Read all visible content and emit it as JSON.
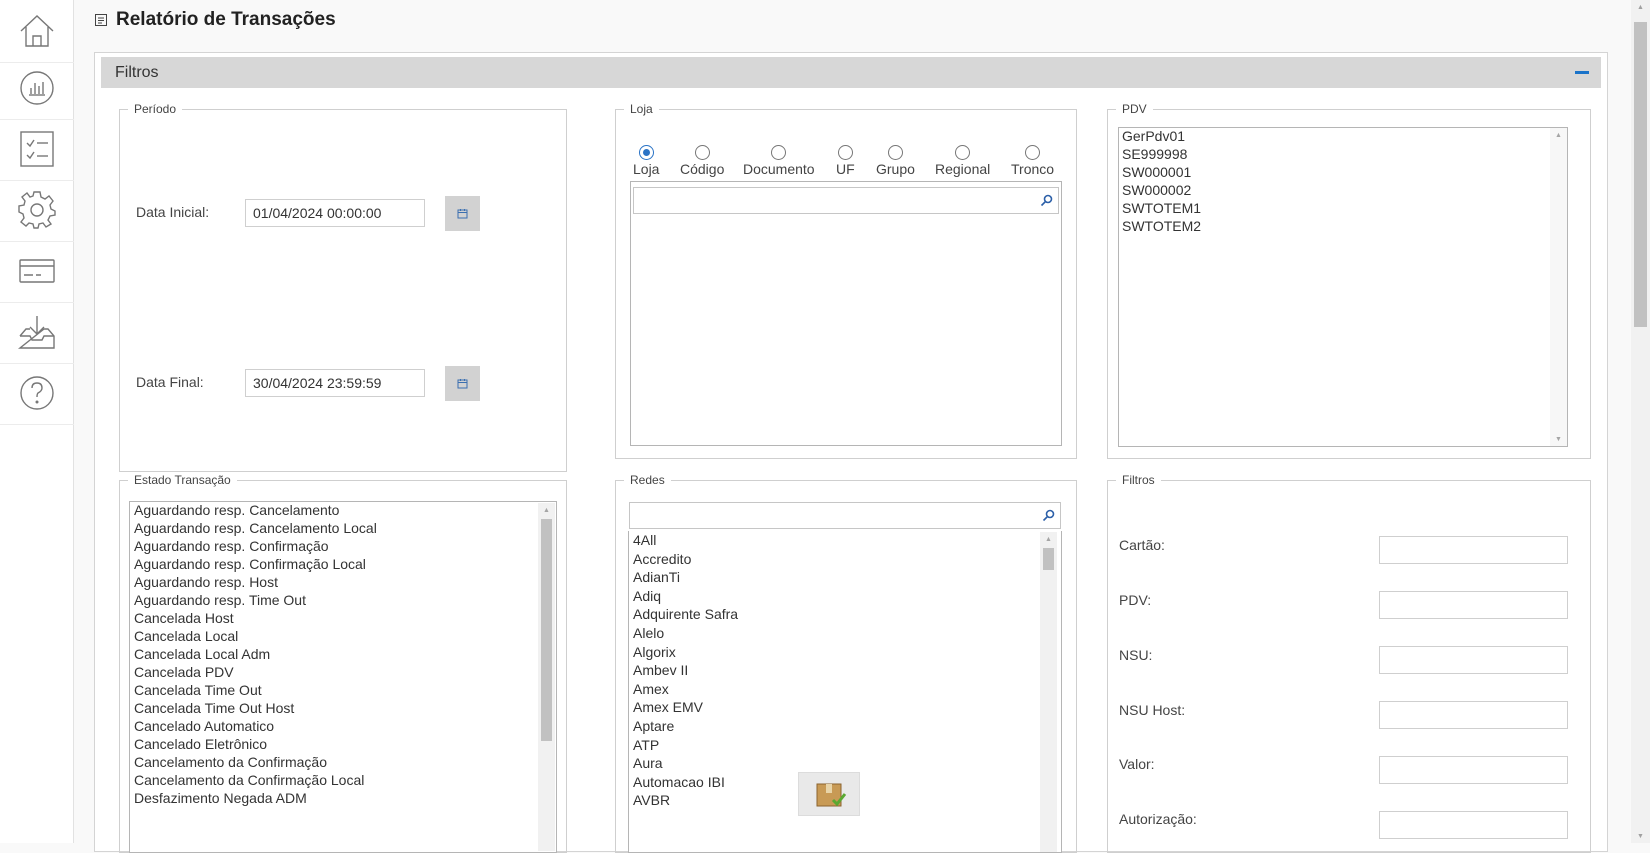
{
  "page": {
    "title": "Relatório de Transações"
  },
  "sidebar": {
    "items": [
      {
        "icon": "home-icon"
      },
      {
        "icon": "chart-icon"
      },
      {
        "icon": "checklist-icon"
      },
      {
        "icon": "gear-icon"
      },
      {
        "icon": "card-icon"
      },
      {
        "icon": "download-tray-icon"
      },
      {
        "icon": "help-icon"
      }
    ]
  },
  "filters_panel": {
    "title": "Filtros",
    "collapse_icon": "minus-icon"
  },
  "periodo": {
    "legend": "Período",
    "start_label": "Data Inicial:",
    "start_value": "01/04/2024 00:00:00",
    "end_label": "Data Final:",
    "end_value": "30/04/2024 23:59:59"
  },
  "loja": {
    "legend": "Loja",
    "options": [
      "Loja",
      "Código",
      "Documento",
      "UF",
      "Grupo",
      "Regional",
      "Tronco"
    ],
    "selected": "Loja",
    "search_value": ""
  },
  "pdv": {
    "legend": "PDV",
    "items": [
      "GerPdv01",
      "SE999998",
      "SW000001",
      "SW000002",
      "SWTOTEM1",
      "SWTOTEM2"
    ]
  },
  "estado_transacao": {
    "legend": "Estado Transação",
    "items": [
      "Aguardando resp. Cancelamento",
      "Aguardando resp. Cancelamento Local",
      "Aguardando resp. Confirmação",
      "Aguardando resp. Confirmação Local",
      "Aguardando resp. Host",
      "Aguardando resp. Time Out",
      "Cancelada Host",
      "Cancelada Local",
      "Cancelada Local Adm",
      "Cancelada PDV",
      "Cancelada Time Out",
      "Cancelada Time Out Host",
      "Cancelado Automatico",
      "Cancelado Eletrônico",
      "Cancelamento da Confirmação",
      "Cancelamento da Confirmação Local",
      "Desfazimento Negada ADM"
    ]
  },
  "redes": {
    "legend": "Redes",
    "search_value": "",
    "items": [
      "4All",
      "Accredito",
      "AdianTi",
      "Adiq",
      "Adquirente Safra",
      "Alelo",
      "Algorix",
      "Ambev II",
      "Amex",
      "Amex EMV",
      "Aptare",
      "ATP",
      "Aura",
      "Automacao IBI",
      "AVBR"
    ]
  },
  "filtros": {
    "legend": "Filtros",
    "fields": [
      {
        "label": "Cartão:",
        "value": ""
      },
      {
        "label": "PDV:",
        "value": ""
      },
      {
        "label": "NSU:",
        "value": ""
      },
      {
        "label": "NSU Host:",
        "value": ""
      },
      {
        "label": "Valor:",
        "value": ""
      },
      {
        "label": "Autorização:",
        "value": ""
      }
    ]
  },
  "colors": {
    "accent": "#2a73c6",
    "header_bg": "#d7d7d7"
  }
}
